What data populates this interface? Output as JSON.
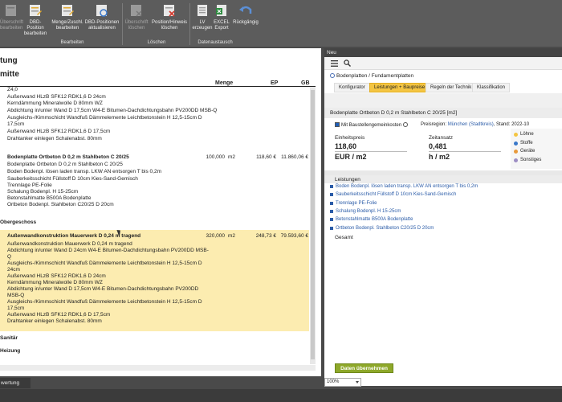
{
  "ribbon": {
    "buttons": [
      {
        "label": "Überschrift\nbearbeiten",
        "icon": "heading-edit-icon",
        "disabled": true
      },
      {
        "label": "DBD-Position\nbearbeiten",
        "icon": "position-edit-icon",
        "disabled": false
      },
      {
        "label": "Menge/Zuschl.\nbearbeiten",
        "icon": "quantity-edit-icon",
        "disabled": false
      },
      {
        "label": "DBD-Positionen\naktualisieren",
        "icon": "refresh-icon",
        "disabled": false
      },
      {
        "label": "Überschrift\nlöschen",
        "icon": "heading-delete-icon",
        "disabled": true
      },
      {
        "label": "Position/Hinweis\nlöschen",
        "icon": "position-delete-icon",
        "disabled": false
      },
      {
        "label": "LV\nerzeugen",
        "icon": "lv-create-icon",
        "disabled": false
      },
      {
        "label": "EXCEL\nExport",
        "icon": "excel-icon",
        "disabled": false
      },
      {
        "label": "Rückgängig",
        "icon": "undo-icon",
        "disabled": false
      }
    ],
    "groups": [
      "Bearbeiten",
      "Löschen",
      "Datenaustausch"
    ]
  },
  "left": {
    "title": "tung",
    "subtitle": "mitte",
    "columns": {
      "menge": "Menge",
      "ep": "EP",
      "gb": "GB"
    },
    "block1": [
      "Z4,0",
      "Außenwand HLzB SFK12 RDK1,6 D 24cm",
      "Kerndämmung Mineralwolle D 80mm WZ",
      "Abdichtung in/unter Wand D 17,5cm W4-E Bitumen-Dachdichtungsbahn PV200DD MSB-Q",
      "Ausgleichs-/Kimmschicht Wandfuß Dämmelemente Leichtbetonstein H 12,5-15cm D",
      "17,5cm",
      "Außenwand HLzB SFK12 RDK1,6 D 17,5cm",
      "Drahtanker einlegen Schalenabst. 80mm"
    ],
    "pos1": {
      "title": "Bodenplatte Ortbeton D 0,2 m Stahlbeton C 20/25",
      "menge": "100,000",
      "unit": "m2",
      "ep": "118,60 €",
      "gb": "11.860,06 €",
      "lines": [
        "Bodenplatte Ortbeton D 0,2 m Stahlbeton C 20/25",
        "Boden Bodenpl. lösen laden transp. LKW AN entsorgen T bis 0,2m",
        "Sauberkeitsschicht Füllstoff D 10cm Kies-Sand-Gemisch",
        "Trennlage PE-Folie",
        "Schalung Bodenpl. H 15-25cm",
        "Betonstahlmatte B500A Bodenplatte",
        "Ortbeton Bodenpl. Stahlbeton C20/25 D 20cm"
      ]
    },
    "section_og": "Obergeschoss",
    "pos2": {
      "title": "Außenwandkonstruktion Mauerwerk D 0,24 m tragend",
      "menge": "320,000",
      "unit": "m2",
      "ep": "248,73 €",
      "gb": "79.593,60 €",
      "lines": [
        "Außenwandkonstruktion Mauerwerk D 0,24 m tragend",
        "Abdichtung in/unter Wand D 24cm W4-E Bitumen-Dachdichtungsbahn PV200DD MSB-",
        "Q",
        "Ausgleichs-/Kimmschicht Wandfuß Dämmelemente Leichtbetonstein H 12,5-15cm D",
        "24cm",
        "Außenwand HLzB SFK12 RDK1,6 D 24cm",
        "Kerndämmung Mineralwolle D 80mm WZ",
        "Abdichtung in/unter Wand D 17,5cm W4-E Bitumen-Dachdichtungsbahn PV200DD",
        "MSB-Q",
        "Ausgleichs-/Kimmschicht Wandfuß Dämmelemente Leichtbetonstein H 12,5-15cm D",
        "17,5cm",
        "Außenwand HLzB SFK12 RDK1,6 D 17,5cm",
        "Drahtanker einlegen Schalenabst. 80mm"
      ]
    },
    "section_sanitaer": "Sanitär",
    "section_heizung": "Heizung"
  },
  "bottom_tab": "wertung",
  "right": {
    "panel_title": "Neu",
    "breadcrumb": "Bodenplatten / Fundamentplatten",
    "tabs": [
      "Konfigurator",
      "Leistungen + Baupreise",
      "Regeln der Technik",
      "Klassifikation"
    ],
    "active_tab": 1,
    "item_title": "Bodenplatte Ortbeton D 0,2 m Stahlbeton C 20/25 [m2]",
    "checkbox_label": "Mit Baustellengemeinkosten",
    "region_prefix": "Preisregion:",
    "region_link": "München (Stadtkreis)",
    "region_suffix": ", Stand: 2022-10",
    "unit_price_label": "Einheitspreis",
    "unit_price_value": "118,60",
    "unit_price_unit": "EUR / m2",
    "time_label": "Zeitansatz",
    "time_value": "0,481",
    "time_unit": "h / m2",
    "legend": [
      {
        "label": "Löhne",
        "color": "#f4c542"
      },
      {
        "label": "Stoffe",
        "color": "#3a78c9"
      },
      {
        "label": "Geräte",
        "color": "#e89a3c"
      },
      {
        "label": "Sonstiges",
        "color": "#9d8ec4"
      }
    ],
    "leistungen_header": "Leistungen",
    "leistungen": [
      "Boden Bodenpl. lösen laden transp. LKW AN entsorgen T bis 0,2m",
      "Sauberkeitsschicht Füllstoff D 10cm Kies-Sand-Gemisch",
      "Trennlage PE-Folie",
      "Schalung Bodenpl. H 15-25cm",
      "Betonstahlmatte B500A Bodenplatte",
      "Ortbeton Bodenpl. Stahlbeton C20/25 D 20cm"
    ],
    "gesamt": "Gesamt",
    "take_button": "Daten übernehmen"
  },
  "zoom": "100%"
}
